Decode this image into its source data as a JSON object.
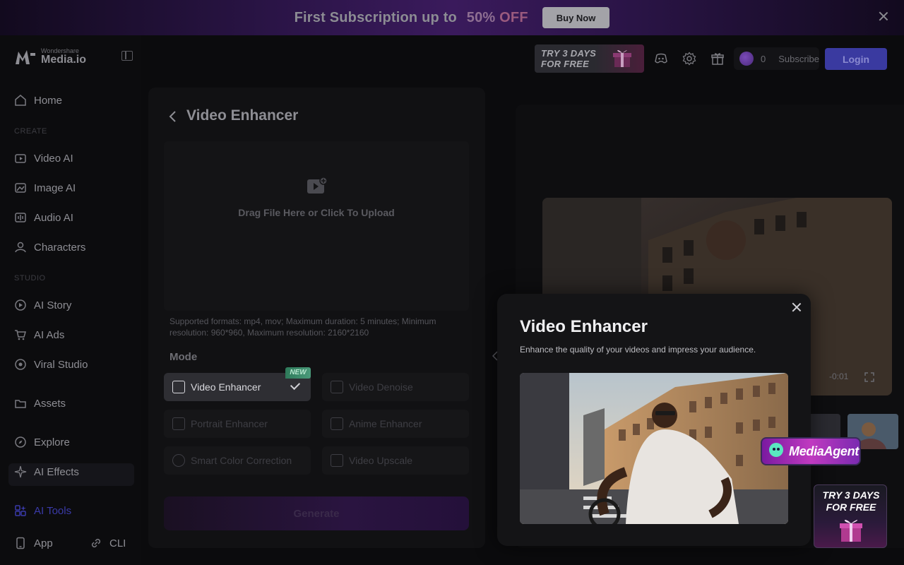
{
  "promo": {
    "text_main": "First Subscription up to",
    "text_pct": "50%",
    "text_off": "OFF",
    "button": "Buy Now"
  },
  "brand": {
    "small": "Wondershare",
    "big": "Media.io"
  },
  "sidebar": {
    "home": "Home",
    "section_create": "CREATE",
    "video_ai": "Video AI",
    "image_ai": "Image AI",
    "audio_ai": "Audio AI",
    "characters": "Characters",
    "section_studio": "STUDIO",
    "ai_story": "AI Story",
    "ai_ads": "AI Ads",
    "viral_studio": "Viral Studio",
    "assets": "Assets",
    "explore": "Explore",
    "ai_effects": "AI Effects",
    "ai_tools": "AI Tools",
    "app": "App",
    "cli": "CLI"
  },
  "topbar": {
    "try_line1": "TRY 3 DAYS",
    "try_line2": "FOR FREE",
    "credits": "0",
    "subscribe": "Subscribe",
    "login": "Login"
  },
  "panel": {
    "title": "Video Enhancer",
    "upload_text": "Drag File Here or Click To Upload",
    "formats": "Supported formats: mp4, mov; Maximum duration: 5 minutes; Minimum resolution: 960*960, Maximum resolution: 2160*2160",
    "mode_label": "Mode",
    "new_tag": "NEW",
    "modes": [
      "Video Enhancer",
      "Video Denoise",
      "Portrait Enhancer",
      "Anime Enhancer",
      "Smart Color Correction",
      "Video Upscale"
    ],
    "generate": "Generate"
  },
  "preview": {
    "timecode": "-0:01"
  },
  "modal": {
    "title": "Video Enhancer",
    "description": "Enhance the quality of your videos and impress your audience."
  },
  "floating": {
    "agent": "MediaAgent",
    "try_line1": "TRY 3 DAYS",
    "try_line2": "FOR FREE"
  },
  "colors": {
    "accent": "#3a3aa0",
    "background": "#0b0b0d"
  }
}
